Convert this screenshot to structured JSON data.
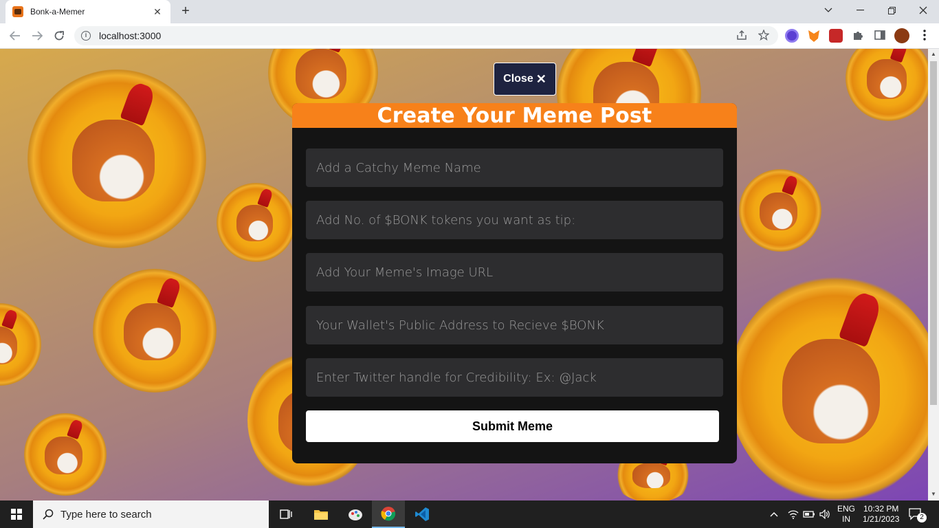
{
  "browser": {
    "tab_title": "Bonk-a-Memer",
    "tab_close": "✕",
    "new_tab": "+",
    "url": "localhost:3000",
    "window_controls": [
      "chevron-down-icon",
      "minimize-icon",
      "restore-icon",
      "close-icon"
    ]
  },
  "page": {
    "close_label": "Close",
    "close_icon": "✕",
    "title": "Create Your Meme Post",
    "fields": [
      {
        "placeholder": "Add a Catchy Meme Name"
      },
      {
        "placeholder": "Add No. of $BONK tokens you want as tip:"
      },
      {
        "placeholder": "Add Your Meme's Image URL"
      },
      {
        "placeholder": "Your Wallet's Public Address to Recieve $BONK"
      },
      {
        "placeholder": "Enter Twitter handle for Credibility: Ex: @Jack"
      }
    ],
    "submit_label": "Submit Meme",
    "colors": {
      "header": "#f7811a",
      "modal": "#141414",
      "field": "#2d2d2f",
      "close_button": "#1e2340"
    }
  },
  "taskbar": {
    "search_placeholder": "Type here to search",
    "language": "ENG",
    "region": "IN",
    "time": "10:32 PM",
    "date": "1/21/2023",
    "notifications": "2"
  }
}
